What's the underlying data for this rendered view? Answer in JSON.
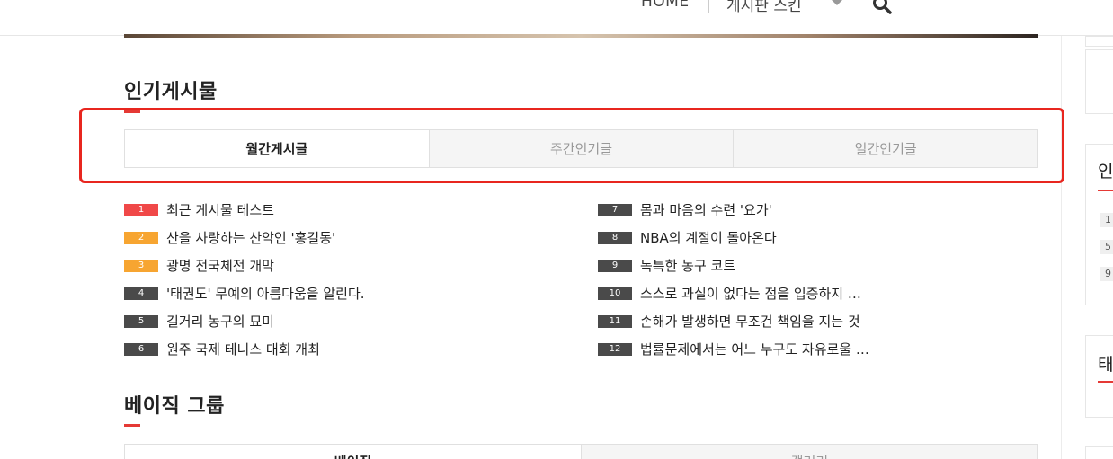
{
  "nav": {
    "home": "HOME",
    "board_skin": "게시판 스킨"
  },
  "popular": {
    "title": "인기게시물",
    "tabs": [
      "월간게시글",
      "주간인기글",
      "일간인기글"
    ],
    "active_tab": 0,
    "left_posts": [
      {
        "num": "1",
        "title": "최근 게시물 테스트",
        "color": "#f04848"
      },
      {
        "num": "2",
        "title": "산을 사랑하는 산악인 '홍길동'",
        "color": "#f7a531"
      },
      {
        "num": "3",
        "title": "광명 전국체전 개막",
        "color": "#f7a531"
      },
      {
        "num": "4",
        "title": "'태권도' 무예의 아름다움을 알린다.",
        "color": "#4a4a4a"
      },
      {
        "num": "5",
        "title": "길거리 농구의 묘미",
        "color": "#4a4a4a"
      },
      {
        "num": "6",
        "title": "원주 국제 테니스 대회 개최",
        "color": "#4a4a4a"
      }
    ],
    "right_posts": [
      {
        "num": "7",
        "title": "몸과 마음의 수련 '요가'",
        "color": "#4a4a4a"
      },
      {
        "num": "8",
        "title": "NBA의 계절이 돌아온다",
        "color": "#4a4a4a"
      },
      {
        "num": "9",
        "title": "독특한 농구 코트",
        "color": "#4a4a4a"
      },
      {
        "num": "10",
        "title": "스스로 과실이 없다는 점을 입증하지 …",
        "color": "#4a4a4a"
      },
      {
        "num": "11",
        "title": "손해가 발생하면 무조건 책임을 지는 것",
        "color": "#4a4a4a"
      },
      {
        "num": "12",
        "title": "법률문제에서는 어느 누구도 자유로울 …",
        "color": "#4a4a4a"
      }
    ]
  },
  "basic_group": {
    "title": "베이직 그룹",
    "tabs": [
      "베이직",
      "갤러리"
    ]
  },
  "sidebar": {
    "box1_title": "인",
    "box1_nums": [
      "1",
      "5",
      "9"
    ],
    "box2_title": "태"
  },
  "colors": {
    "accent_red": "#e53935",
    "highlight_border": "#e8261f"
  }
}
